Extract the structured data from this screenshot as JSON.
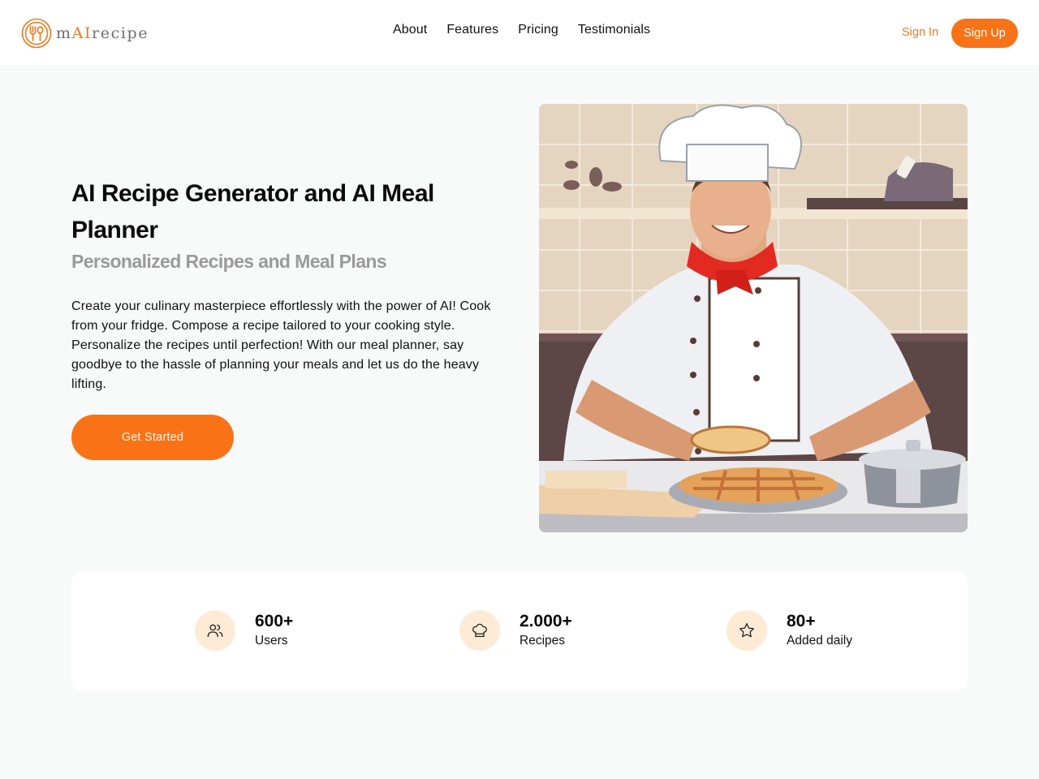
{
  "brand": {
    "name_prefix": "m",
    "name_highlight": "AI",
    "name_suffix": "recipe",
    "logo_icon": "fork-spoon-plate-icon",
    "accent_color": "#f97316"
  },
  "nav": {
    "items": [
      {
        "label": "About"
      },
      {
        "label": "Features"
      },
      {
        "label": "Pricing"
      },
      {
        "label": "Testimonials"
      }
    ]
  },
  "auth": {
    "sign_in_label": "Sign In",
    "sign_up_label": "Sign Up"
  },
  "hero": {
    "title": "AI Recipe Generator and AI Meal Planner",
    "subtitle": "Personalized Recipes and Meal Plans",
    "description": "Create your culinary masterpiece effortlessly with the power of AI! Cook from your fridge. Compose a recipe tailored to your cooking style. Personalize the recipes until perfection! With our meal planner, say goodbye to the hassle of planning your meals and let us do the heavy lifting.",
    "cta_label": "Get Started",
    "image_alt": "Illustrated smiling chef in a white uniform and red neckerchief holding a pie in a kitchen"
  },
  "stats": [
    {
      "icon": "users-icon",
      "value": "600+",
      "label": "Users"
    },
    {
      "icon": "chef-hat-icon",
      "value": "2.000+",
      "label": "Recipes"
    },
    {
      "icon": "star-icon",
      "value": "80+",
      "label": "Added daily"
    }
  ]
}
